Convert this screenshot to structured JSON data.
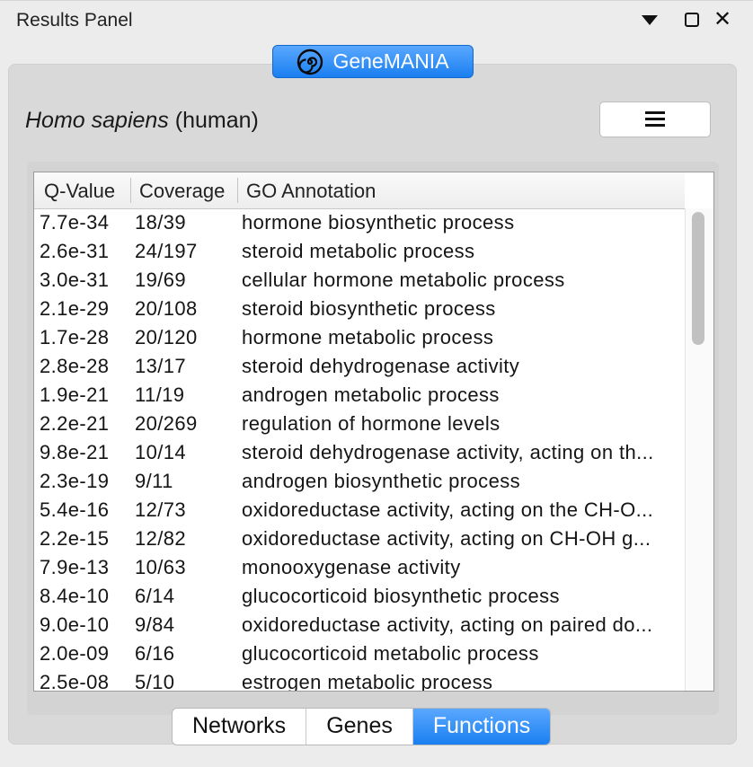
{
  "window": {
    "title": "Results Panel"
  },
  "app": {
    "name": "GeneMANIA"
  },
  "organism": {
    "scientific": "Homo sapiens",
    "common": "(human)"
  },
  "table": {
    "columns": [
      "Q-Value",
      "Coverage",
      "GO Annotation"
    ],
    "rows": [
      {
        "q": "7.7e-34",
        "coverage": "18/39",
        "annotation": "hormone biosynthetic process"
      },
      {
        "q": "2.6e-31",
        "coverage": "24/197",
        "annotation": "steroid metabolic process"
      },
      {
        "q": "3.0e-31",
        "coverage": "19/69",
        "annotation": "cellular hormone metabolic process"
      },
      {
        "q": "2.1e-29",
        "coverage": "20/108",
        "annotation": "steroid biosynthetic process"
      },
      {
        "q": "1.7e-28",
        "coverage": "20/120",
        "annotation": "hormone metabolic process"
      },
      {
        "q": "2.8e-28",
        "coverage": "13/17",
        "annotation": "steroid dehydrogenase activity"
      },
      {
        "q": "1.9e-21",
        "coverage": "11/19",
        "annotation": "androgen metabolic process"
      },
      {
        "q": "2.2e-21",
        "coverage": "20/269",
        "annotation": "regulation of hormone levels"
      },
      {
        "q": "9.8e-21",
        "coverage": "10/14",
        "annotation": "steroid dehydrogenase activity, acting on th..."
      },
      {
        "q": "2.3e-19",
        "coverage": "9/11",
        "annotation": "androgen biosynthetic process"
      },
      {
        "q": "5.4e-16",
        "coverage": "12/73",
        "annotation": "oxidoreductase activity, acting on the CH-O..."
      },
      {
        "q": "2.2e-15",
        "coverage": "12/82",
        "annotation": "oxidoreductase activity, acting on CH-OH g..."
      },
      {
        "q": "7.9e-13",
        "coverage": "10/63",
        "annotation": "monooxygenase activity"
      },
      {
        "q": "8.4e-10",
        "coverage": "6/14",
        "annotation": "glucocorticoid biosynthetic process"
      },
      {
        "q": "9.0e-10",
        "coverage": "9/84",
        "annotation": "oxidoreductase activity, acting on paired do..."
      },
      {
        "q": "2.0e-09",
        "coverage": "6/16",
        "annotation": "glucocorticoid metabolic process"
      },
      {
        "q": "2.5e-08",
        "coverage": "5/10",
        "annotation": "estrogen metabolic process"
      }
    ]
  },
  "tabs": [
    {
      "label": "Networks",
      "active": false
    },
    {
      "label": "Genes",
      "active": false
    },
    {
      "label": "Functions",
      "active": true
    }
  ],
  "icons": {
    "app": "genemania-spiral-icon",
    "menu": "hamburger-menu-icon",
    "dropdown": "triangle-down-icon",
    "float": "float-window-icon",
    "close": "close-icon"
  },
  "colors": {
    "accent": "#1a7ff0",
    "panel": "#d9d9d9"
  }
}
